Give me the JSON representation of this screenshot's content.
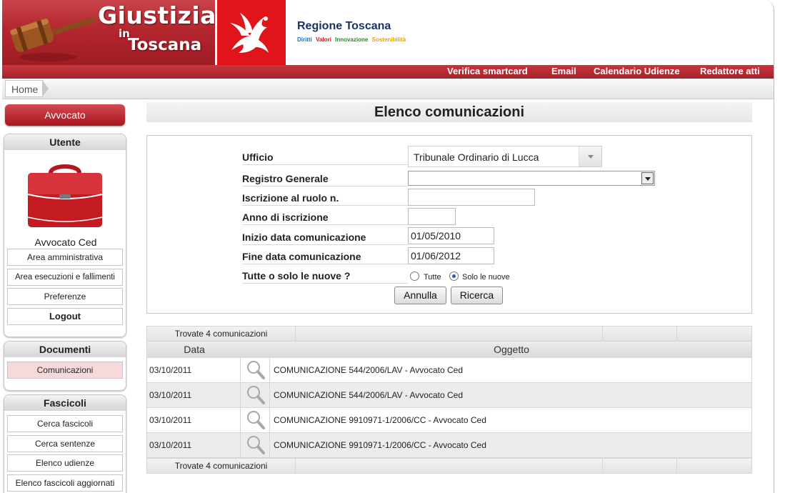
{
  "header": {
    "brand_line1": "Giustizia",
    "brand_line2": "in",
    "brand_line3": "Toscana",
    "region_name": "Regione Toscana",
    "motto": [
      {
        "text": "Diritti",
        "color": "#1b6fc0"
      },
      {
        "text": "Valori",
        "color": "#c0161d"
      },
      {
        "text": "Innovazione",
        "color": "#2a8a2a"
      },
      {
        "text": "Sostenibilità",
        "color": "#e0a400"
      }
    ]
  },
  "topnav": [
    "Verifica smartcard",
    "Email",
    "Calendario Udienze",
    "Redattore atti"
  ],
  "breadcrumb": {
    "home": "Home"
  },
  "sidebar": {
    "role_button": "Avvocato",
    "user_panel": {
      "title": "Utente",
      "user_name": "Avvocato Ced",
      "items": [
        "Area amministrativa",
        "Area esecuzioni e fallimenti",
        "Preferenze",
        "Logout"
      ]
    },
    "documents_panel": {
      "title": "Documenti",
      "items": [
        "Comunicazioni"
      ]
    },
    "files_panel": {
      "title": "Fascicoli",
      "items": [
        "Cerca fascicoli",
        "Cerca sentenze",
        "Elenco udienze",
        "Elenco fascicoli aggiornati"
      ]
    }
  },
  "page": {
    "title": "Elenco comunicazioni"
  },
  "form": {
    "ufficio_label": "Ufficio",
    "ufficio_value": "Tribunale Ordinario di Lucca",
    "registro_label": "Registro Generale",
    "registro_value": "",
    "ruolo_label": "Iscrizione al ruolo n.",
    "ruolo_value": "",
    "anno_label": "Anno di iscrizione",
    "anno_value": "",
    "inizio_label": "Inizio data comunicazione",
    "inizio_value": "01/05/2010",
    "fine_label": "Fine data comunicazione",
    "fine_value": "01/06/2012",
    "tutte_label": "Tutte o solo le nuove ?",
    "radio_all": "Tutte",
    "radio_new": "Solo le nuove",
    "selected": "Solo le nuove",
    "annulla": "Annulla",
    "ricerca": "Ricerca"
  },
  "results": {
    "found_text": "Trovate 4 comunicazioni",
    "col_date": "Data",
    "col_object": "Oggetto",
    "rows": [
      {
        "date": "03/10/2011",
        "object": "COMUNICAZIONE 544/2006/LAV - Avvocato Ced"
      },
      {
        "date": "03/10/2011",
        "object": "COMUNICAZIONE 544/2006/LAV - Avvocato Ced"
      },
      {
        "date": "03/10/2011",
        "object": "COMUNICAZIONE 9910971-1/2006/CC - Avvocato Ced"
      },
      {
        "date": "03/10/2011",
        "object": "COMUNICAZIONE 9910971-1/2006/CC - Avvocato Ced"
      }
    ]
  }
}
